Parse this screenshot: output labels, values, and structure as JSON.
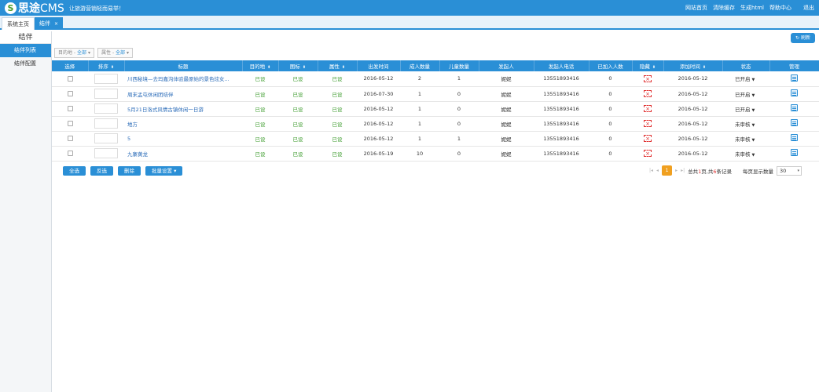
{
  "header": {
    "logo_mark": "S",
    "logo_name": "思途",
    "logo_suffix": "CMS",
    "slogan": "让旅游营销轻而易举！",
    "links": [
      "网站首页",
      "清除缓存",
      "生成html",
      "帮助中心"
    ],
    "logout": "退出"
  },
  "tabs": {
    "home": "系统主页",
    "active": "结伴",
    "close": "×"
  },
  "sidebar": {
    "title": "结伴",
    "items": [
      {
        "label": "结伴列表",
        "active": true
      },
      {
        "label": "结伴配置",
        "active": false
      }
    ]
  },
  "toolbar": {
    "refresh_icon": "refresh-icon",
    "refresh_label": "刷新"
  },
  "filters": [
    {
      "label": "目的地 -",
      "value": "全部"
    },
    {
      "label": "属性 -",
      "value": "全部"
    }
  ],
  "columns": [
    {
      "label": "选择",
      "sortable": false
    },
    {
      "label": "排序",
      "sortable": true
    },
    {
      "label": "标题",
      "sortable": false
    },
    {
      "label": "目的地",
      "sortable": true
    },
    {
      "label": "图标",
      "sortable": true
    },
    {
      "label": "属性",
      "sortable": true
    },
    {
      "label": "出发时间",
      "sortable": false
    },
    {
      "label": "成人数量",
      "sortable": false
    },
    {
      "label": "儿童数量",
      "sortable": false
    },
    {
      "label": "发起人",
      "sortable": false
    },
    {
      "label": "发起人电话",
      "sortable": false
    },
    {
      "label": "已加入人数",
      "sortable": false
    },
    {
      "label": "隐藏",
      "sortable": true
    },
    {
      "label": "添加时间",
      "sortable": true
    },
    {
      "label": "状态",
      "sortable": false
    },
    {
      "label": "管理",
      "sortable": false
    }
  ],
  "rows": [
    {
      "title": "川西秘境—去玛嘉沟体验最原始的景色炫女...",
      "dest": "已设",
      "icon": "已设",
      "attr": "已设",
      "depart": "2016-05-12",
      "adults": "2",
      "children": "1",
      "initiator": "妮妮",
      "phone": "13551893416",
      "joined": "0",
      "added": "2016-05-12",
      "status": "已开启"
    },
    {
      "title": "周末孟屯休闲团结伴",
      "dest": "已设",
      "icon": "已设",
      "attr": "已设",
      "depart": "2016-07-30",
      "adults": "1",
      "children": "0",
      "initiator": "妮妮",
      "phone": "13551893416",
      "joined": "0",
      "added": "2016-05-12",
      "status": "已开启"
    },
    {
      "title": "5月21日洛式风情古镇休闲一日游",
      "dest": "已设",
      "icon": "已设",
      "attr": "已设",
      "depart": "2016-05-12",
      "adults": "1",
      "children": "0",
      "initiator": "妮妮",
      "phone": "13551893416",
      "joined": "0",
      "added": "2016-05-12",
      "status": "已开启"
    },
    {
      "title": "地方",
      "dest": "已设",
      "icon": "已设",
      "attr": "已设",
      "depart": "2016-05-12",
      "adults": "1",
      "children": "0",
      "initiator": "妮妮",
      "phone": "13551893416",
      "joined": "0",
      "added": "2016-05-12",
      "status": "未审核"
    },
    {
      "title": "5",
      "dest": "已设",
      "icon": "已设",
      "attr": "已设",
      "depart": "2016-05-12",
      "adults": "1",
      "children": "1",
      "initiator": "妮妮",
      "phone": "13551893416",
      "joined": "0",
      "added": "2016-05-12",
      "status": "未审核"
    },
    {
      "title": "九寨黄龙",
      "dest": "已设",
      "icon": "已设",
      "attr": "已设",
      "depart": "2016-05-19",
      "adults": "10",
      "children": "0",
      "initiator": "妮妮",
      "phone": "13551893416",
      "joined": "0",
      "added": "2016-05-12",
      "status": "未审核"
    }
  ],
  "bulk_buttons": {
    "select_all": "全选",
    "invert": "反选",
    "delete": "删除",
    "batch": "批量设置"
  },
  "pager": {
    "current_page": "1",
    "info_prefix": "总共",
    "pages": "1",
    "info_mid": "页,共",
    "records": "6",
    "info_suffix": "条记录",
    "per_page_label": "每页显示数量",
    "per_page": "30"
  },
  "colors": {
    "primary": "#2a8fd6",
    "green": "#3a9a2a",
    "red": "#e03030",
    "orange": "#f0a020"
  }
}
